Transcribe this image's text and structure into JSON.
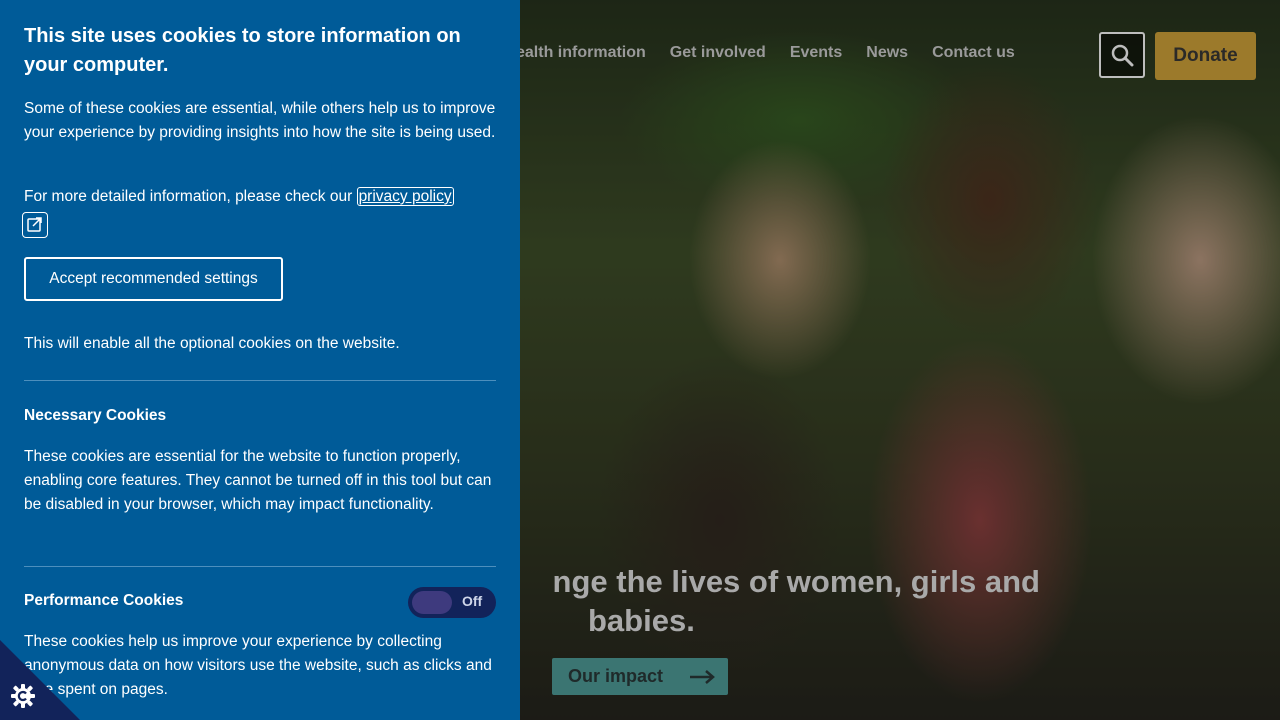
{
  "nav": {
    "items": [
      "ealth information",
      "Get involved",
      "Events",
      "News",
      "Contact us"
    ],
    "donate_label": "Donate"
  },
  "hero": {
    "title_line1": "nge the lives of women, girls and",
    "title_line2": "babies.",
    "impact_label": "Our impact"
  },
  "cookie": {
    "title": "This site uses cookies to store information on your computer.",
    "intro": "Some of these cookies are essential, while others help us to improve your experience by providing insights into how the site is being used.",
    "more_prefix": "For more detailed information, please check our ",
    "privacy_link": "privacy policy",
    "accept_label": "Accept recommended settings",
    "accept_note": "This will enable all the optional cookies on the website.",
    "sections": [
      {
        "title": "Necessary Cookies",
        "body": "These cookies are essential for the website to function properly, enabling core features. They cannot be turned off in this tool but can be disabled in your browser, which may impact functionality."
      },
      {
        "title": "Performance Cookies",
        "body": "These cookies help us improve your experience by collecting anonymous data on how visitors use the website, such as clicks and time spent on pages.",
        "toggle_label": "Off"
      }
    ]
  },
  "colors": {
    "panel_bg": "#005b98",
    "toggle_bg": "#12235a",
    "donate_bg": "#9c7a2b",
    "impact_bg": "#3b7572"
  },
  "icons": [
    "search-icon",
    "external-link-icon",
    "cookie-settings-icon",
    "arrow-right-icon"
  ]
}
